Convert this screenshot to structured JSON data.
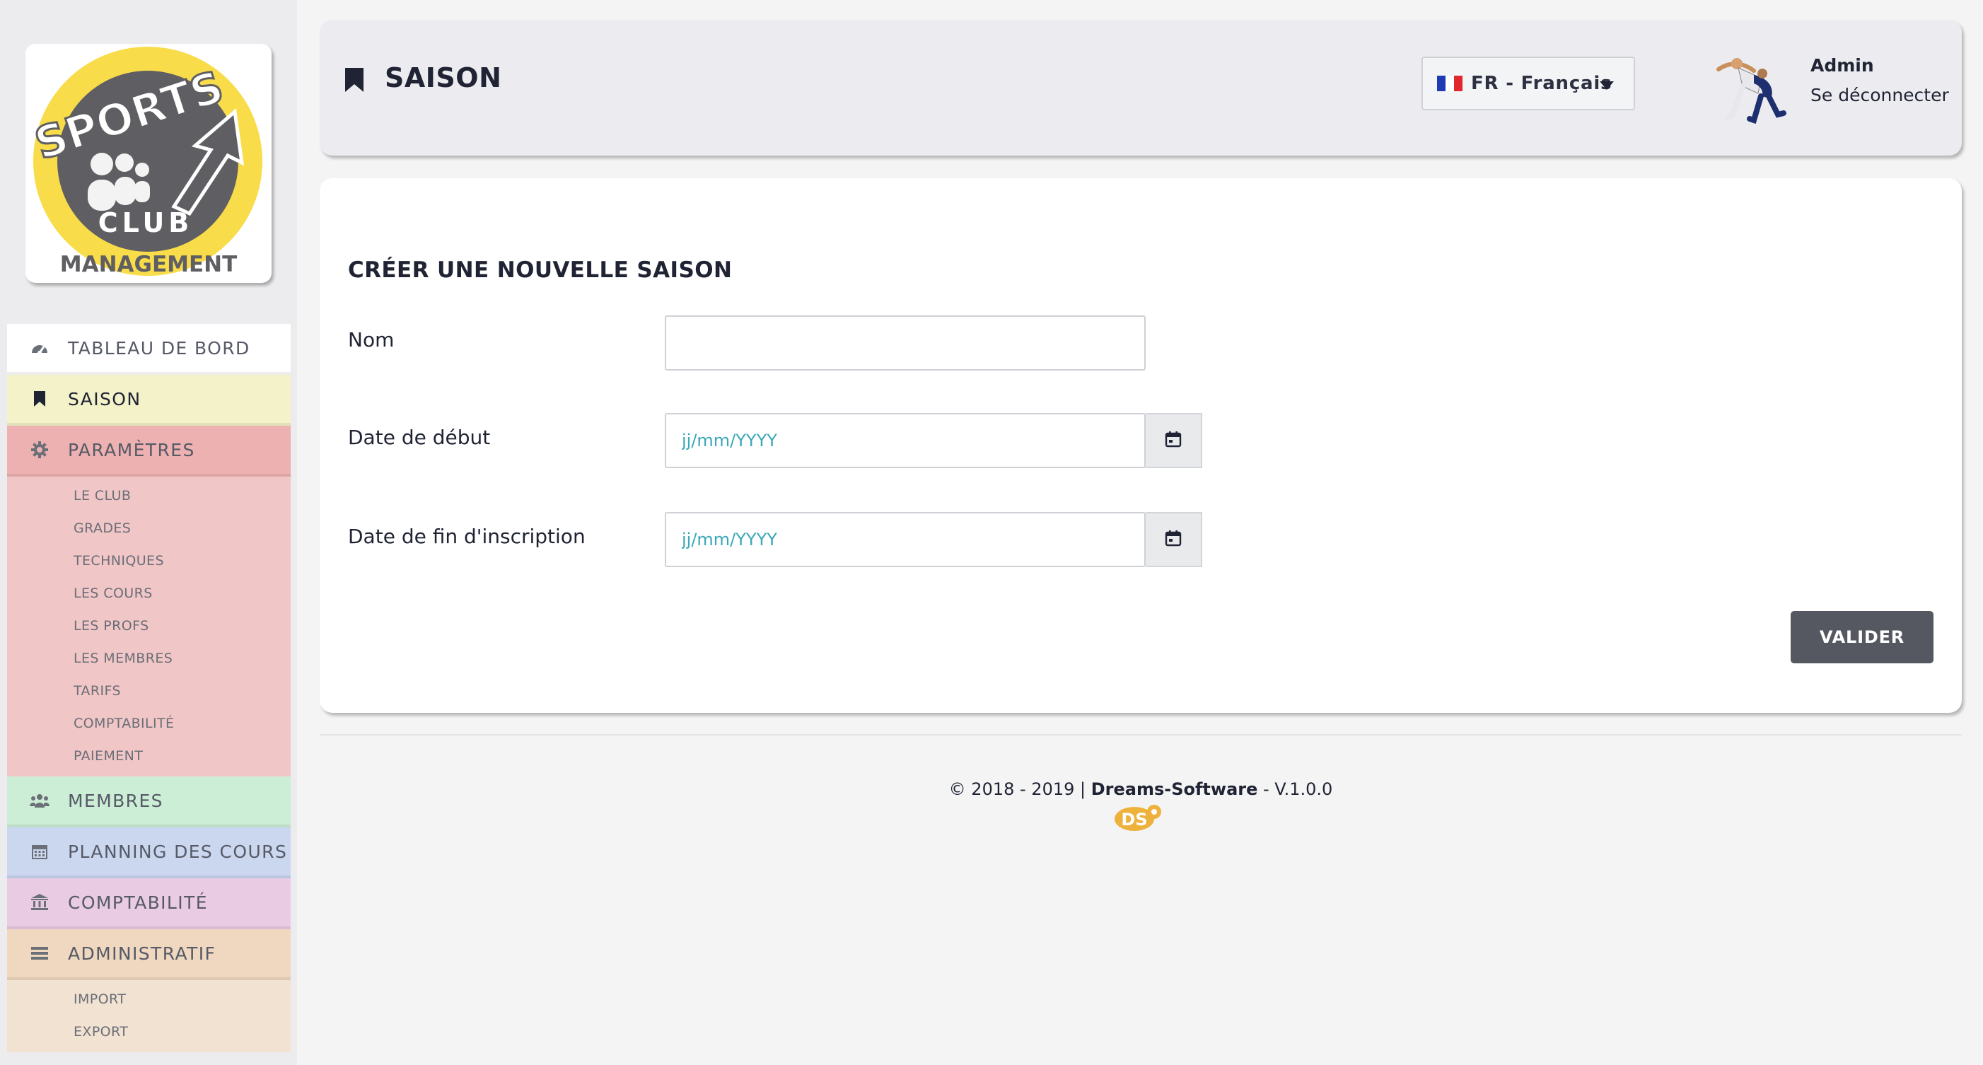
{
  "brand": {
    "logo_text_top": "SPORTS",
    "logo_text_mid": "CLUB",
    "logo_text_bottom": "MANAGEMENT"
  },
  "sidebar": {
    "items": [
      {
        "label": "TABLEAU DE BORD",
        "icon": "dashboard-icon",
        "bg": "#ffffff"
      },
      {
        "label": "SAISON",
        "icon": "bookmark-icon",
        "bg": "#f3f2c8",
        "active": true
      },
      {
        "label": "PARAMÈTRES",
        "icon": "gear-icon",
        "bg": "#eeb1b1",
        "subitems": [
          "LE CLUB",
          "GRADES",
          "TECHNIQUES",
          "LES COURS",
          "LES PROFS",
          "LES MEMBRES",
          "TARIFS",
          "COMPTABILITÉ",
          "PAIEMENT"
        ],
        "sub_bg": "#f1c6c6"
      },
      {
        "label": "MEMBRES",
        "icon": "users-icon",
        "bg": "#cdeed6"
      },
      {
        "label": "PLANNING DES COURS",
        "icon": "calendar-icon",
        "bg": "#cad7ef"
      },
      {
        "label": "COMPTABILITÉ",
        "icon": "bank-icon",
        "bg": "#eacbe4"
      },
      {
        "label": "ADMINISTRATIF",
        "icon": "list-icon",
        "bg": "#efd8bf",
        "subitems": [
          "IMPORT",
          "EXPORT"
        ],
        "sub_bg": "#f2e2d1"
      }
    ]
  },
  "header": {
    "title": "SAISON",
    "language": "FR - Français",
    "user_name": "Admin",
    "logout_label": "Se déconnecter"
  },
  "form": {
    "title": "CRÉER UNE NOUVELLE SAISON",
    "name_label": "Nom",
    "name_value": "",
    "start_label": "Date de début",
    "start_placeholder": "jj/mm/YYYY",
    "end_label": "Date de fin d'inscription",
    "end_placeholder": "jj/mm/YYYY",
    "submit_label": "VALIDER"
  },
  "footer": {
    "copyright": "© 2018 - 2019 | ",
    "company": "Dreams-Software",
    "version": " - V.1.0.0",
    "logo_text": "DS"
  },
  "colors": {
    "accent_yellow": "#f9dc4a",
    "logo_gray": "#5f5f63",
    "button_dark": "#555860",
    "placeholder_teal": "#3aa8b8"
  }
}
